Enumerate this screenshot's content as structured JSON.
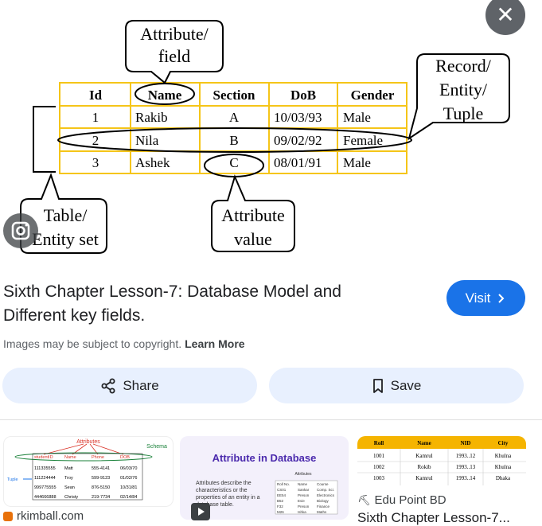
{
  "preview": {
    "table": {
      "headers": [
        "Id",
        "Name",
        "Section",
        "DoB",
        "Gender"
      ],
      "rows": [
        [
          "1",
          "Rakib",
          "A",
          "10/03/93",
          "Male"
        ],
        [
          "2",
          "Nila",
          "B",
          "09/02/92",
          "Female"
        ],
        [
          "3",
          "Ashek",
          "C",
          "08/01/91",
          "Male"
        ]
      ]
    },
    "callouts": {
      "attribute_line1": "Attribute/",
      "attribute_line2": "field",
      "record_line1": "Record/",
      "record_line2": "Entity/",
      "record_line3": "Tuple",
      "table_line1": "Table/",
      "table_line2": "Entity set",
      "value_line1": "Attribute",
      "value_line2": "value"
    }
  },
  "result": {
    "title": "Sixth Chapter Lesson-7: Database Model and Different key fields.",
    "visit_label": "Visit",
    "copyright_text": "Images may be subject to copyright.",
    "learn_more": "Learn More",
    "share_label": "Share",
    "save_label": "Save"
  },
  "related": [
    {
      "source": "rkimball.com",
      "labels": {
        "attributes": "Attributes",
        "schema": "Schema",
        "tuple": "Tuple",
        "headers": [
          "studentID",
          "Name",
          "Phone",
          "DOB"
        ],
        "rows": [
          [
            "111335555",
            "Matt",
            "555-4141",
            "06/03/70"
          ],
          [
            "111224444",
            "Troy",
            "599-9123",
            "01/02/76"
          ],
          [
            "999775555",
            "Sean",
            "876-5150",
            "10/31/81"
          ],
          [
            "444666888",
            "Christy",
            "219-7734",
            "02/14/84"
          ]
        ]
      }
    },
    {
      "title": "Attribute in Database",
      "desc": "Attributes describe the characteristics or the properties of an entity in a database table.",
      "attr_label": "Attributes",
      "headers": [
        "Roll No.",
        "Name",
        "Course"
      ],
      "rows": [
        [
          "CS01",
          "Sankar",
          "Comp. Sci."
        ],
        [
          "EE54",
          "Preson",
          "Electronics"
        ],
        [
          "B52",
          "Evie",
          "Biology"
        ],
        [
          "F32",
          "Preson",
          "Finance"
        ],
        [
          "M26",
          "Ishka",
          "Maths"
        ]
      ]
    },
    {
      "source": "Edu Point BD",
      "caption": "Sixth Chapter Lesson-7...",
      "headers": [
        "Roll",
        "Name",
        "NID",
        "City"
      ],
      "rows": [
        [
          "1001",
          "Kamrul",
          "1993..12",
          "Khulna"
        ],
        [
          "1002",
          "Rokib",
          "1993..13",
          "Khulna"
        ],
        [
          "1003",
          "Kamrul",
          "1993..14",
          "Dhaka"
        ]
      ]
    }
  ],
  "colors": {
    "table_border": "#f5c518",
    "visit_blue": "#1a73e8",
    "pill_bg": "#e8f0fe"
  },
  "icons": [
    "close-icon",
    "lens-icon",
    "chevron-right-icon",
    "share-icon",
    "bookmark-icon",
    "site-favicon",
    "play-icon",
    "edupoint-favicon"
  ]
}
